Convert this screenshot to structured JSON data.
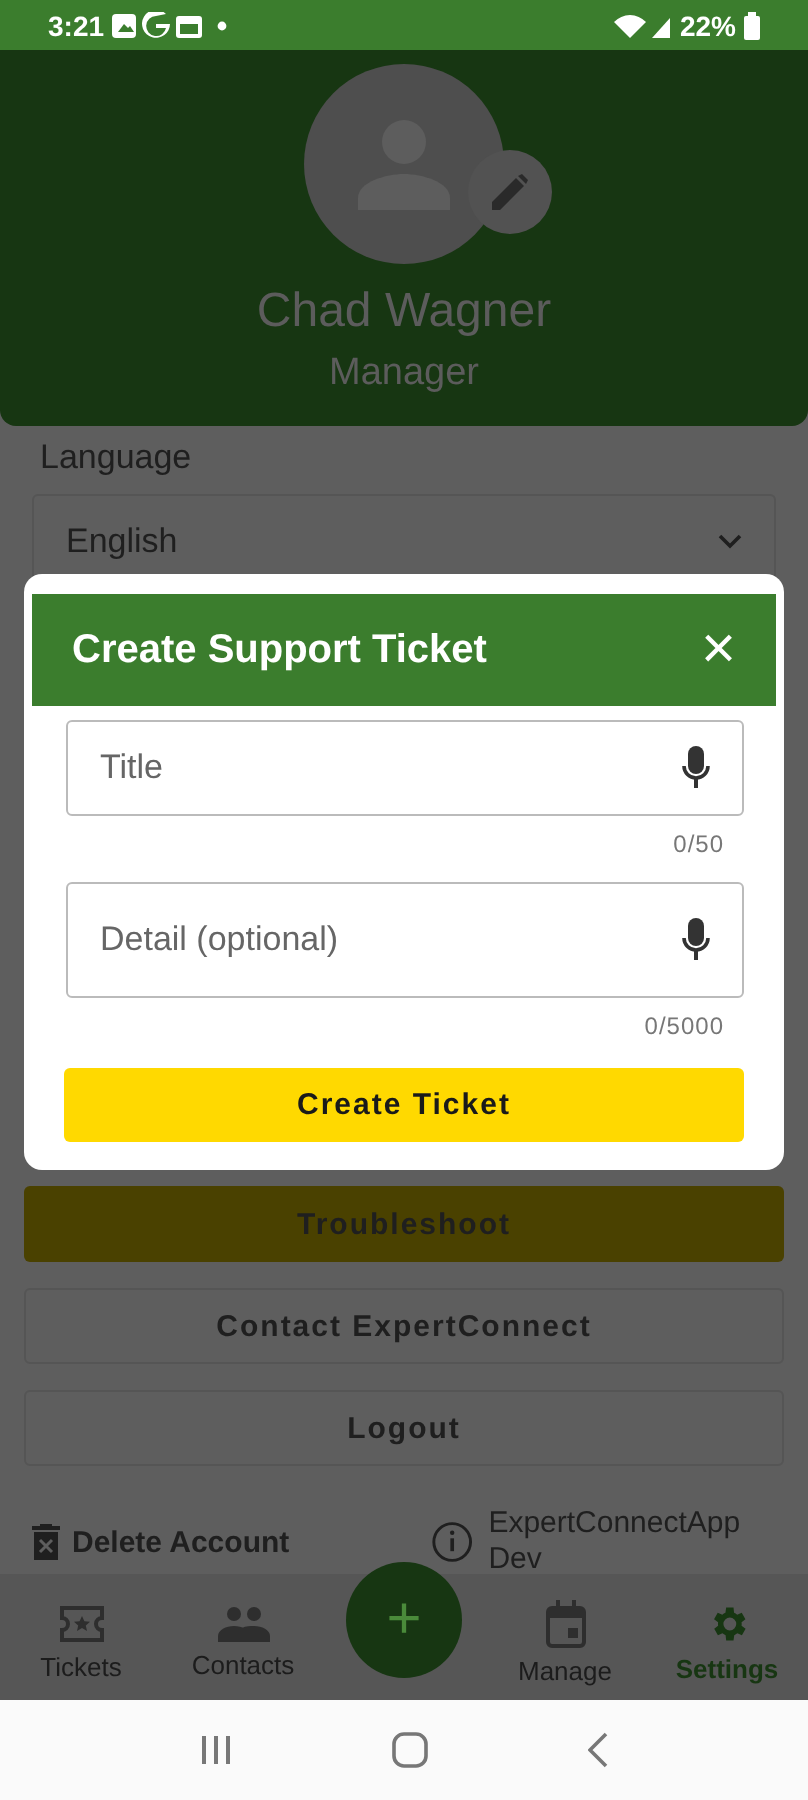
{
  "status_bar": {
    "time": "3:21",
    "battery": "22%"
  },
  "profile": {
    "name": "Chad Wagner",
    "role": "Manager"
  },
  "language": {
    "label": "Language",
    "value": "English"
  },
  "buttons": [
    {
      "label": "Troubleshoot",
      "kind": "primary"
    },
    {
      "label": "Contact ExpertConnect",
      "kind": "outline"
    },
    {
      "label": "Logout",
      "kind": "outline"
    }
  ],
  "footer": {
    "delete_label": "Delete Account",
    "app_name": "ExpertConnectApp Dev"
  },
  "bottom_nav": [
    {
      "label": "Tickets",
      "selected": false
    },
    {
      "label": "Contacts",
      "selected": false
    },
    {
      "label": "Manage",
      "selected": false
    },
    {
      "label": "Settings",
      "selected": true
    }
  ],
  "fab": {
    "symbol": "+"
  },
  "dialog": {
    "title": "Create Support Ticket",
    "close": "×",
    "fields": [
      {
        "placeholder": "Title",
        "counter": "0/50"
      },
      {
        "placeholder": "Detail (optional)",
        "counter": "0/5000"
      }
    ],
    "submit": "Create Ticket"
  }
}
